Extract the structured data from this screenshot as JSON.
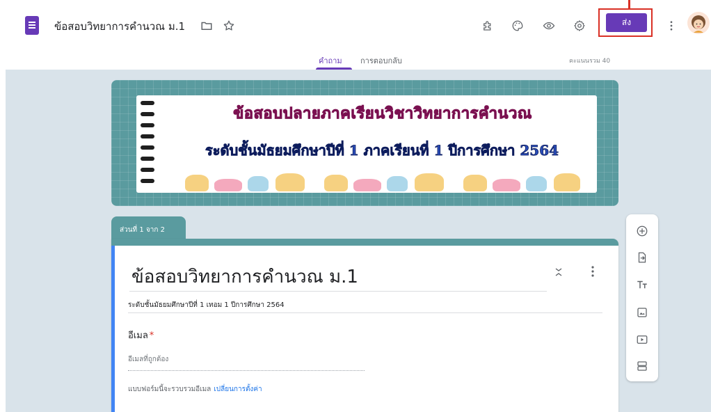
{
  "header": {
    "doc_title": "ข้อสอบวิทยาการคำนวณ ม.1",
    "send_label": "ส่ง",
    "icons": [
      "forms-app-icon",
      "folder-icon",
      "star-icon",
      "addon-puzzle-icon",
      "palette-icon",
      "preview-eye-icon",
      "settings-gear-icon",
      "more-vert-icon"
    ]
  },
  "tabs": {
    "questions": "คำถาม",
    "responses": "การตอบกลับ",
    "total_score": "คะแนนรวม 40"
  },
  "banner": {
    "line1": "ข้อสอบปลายภาคเรียนวิชาวิทยาการคำนวณ",
    "line2": "ระดับชั้นมัธยมศึกษาปีที่ 1 ภาคเรียนที่ 1 ปีการศึกษา 2564"
  },
  "section": {
    "tab_label": "ส่วนที่ 1 จาก 2"
  },
  "form": {
    "title": "ข้อสอบวิทยาการคำนวณ ม.1",
    "description": "ระดับชั้นมัธยมศึกษาปีที่ 1 เทอม 1 ปีการศึกษา 2564",
    "email_label": "อีเมล",
    "required_mark": "*",
    "email_placeholder": "อีเมลที่ถูกต้อง",
    "collect_note": "แบบฟอร์มนี้จะรวบรวมอีเมล",
    "change_settings_link": "เปลี่ยนการตั้งค่า"
  },
  "toolbar": {
    "tools": [
      "add-question-icon",
      "import-questions-icon",
      "add-title-icon",
      "add-image-icon",
      "add-video-icon",
      "add-section-icon"
    ]
  },
  "colors": {
    "accent": "#673ab7",
    "theme": "#5a9b9f",
    "background": "#d9e3ea",
    "highlight_box": "#d93025",
    "link": "#1a73e8"
  }
}
